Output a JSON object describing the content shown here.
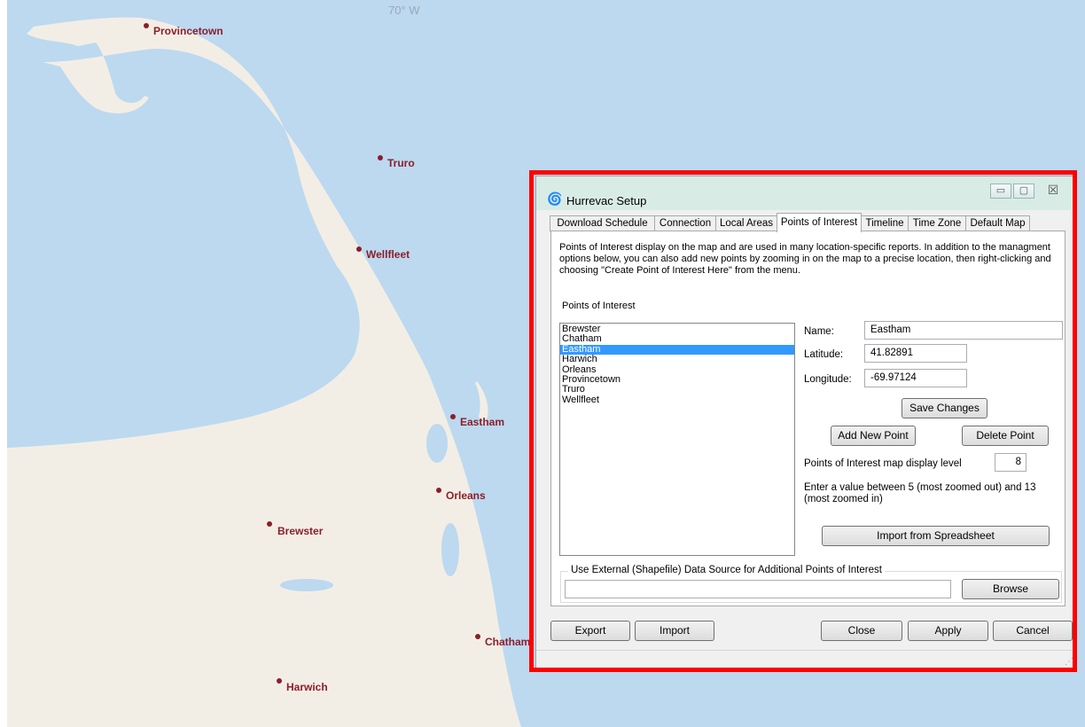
{
  "map": {
    "longitude_label": "70° W",
    "colors": {
      "water": "#bcd9f0",
      "land": "#f3eee5",
      "town": "#8b1e2a"
    },
    "towns": [
      {
        "name": "Provincetown"
      },
      {
        "name": "Truro"
      },
      {
        "name": "Wellfleet"
      },
      {
        "name": "Eastham"
      },
      {
        "name": "Orleans"
      },
      {
        "name": "Brewster"
      },
      {
        "name": "Chatham"
      },
      {
        "name": "Harwich"
      }
    ]
  },
  "dialog": {
    "title": "Hurrevac Setup",
    "title_icon": "hurricane-icon",
    "window_controls": {
      "minimize": "▭",
      "maximize": "▢",
      "close": "☒"
    },
    "tabs": [
      {
        "label": "Download Schedule",
        "active": false
      },
      {
        "label": "Connection",
        "active": false
      },
      {
        "label": "Local Areas",
        "active": false
      },
      {
        "label": "Points of Interest",
        "active": true
      },
      {
        "label": "Timeline",
        "active": false
      },
      {
        "label": "Time Zone",
        "active": false
      },
      {
        "label": "Default Map",
        "active": false
      }
    ],
    "description": "Points of Interest display on the map and are used in many location-specific reports.  In addition to the managment options below, you can also add new points by zooming in on the map to a precise location, then right-clicking and choosing \"Create Point of Interest Here\" from the menu.",
    "list_label": "Points of Interest",
    "points": [
      "Brewster",
      "Chatham",
      "Eastham",
      "Harwich",
      "Orleans",
      "Provincetown",
      "Truro",
      "Wellfleet"
    ],
    "selected_point": "Eastham",
    "name_label": "Name:",
    "name_value": "Eastham",
    "latitude_label": "Latitude:",
    "latitude_value": "41.82891",
    "longitude_label": "Longitude:",
    "longitude_value": "-69.97124",
    "save_changes": "Save Changes",
    "add_new_point": "Add New Point",
    "delete_point": "Delete Point",
    "display_level_label": "Points of Interest map display level",
    "display_level_value": "8",
    "display_level_hint": "Enter a value between 5 (most zoomed out) and 13 (most zoomed in)",
    "import_spreadsheet": "Import from Spreadsheet",
    "external_source_label": "Use External (Shapefile) Data Source for Additional Points of Interest",
    "external_source_value": "",
    "browse": "Browse",
    "export": "Export",
    "import": "Import",
    "close": "Close",
    "apply": "Apply",
    "cancel": "Cancel",
    "highlight_color": "#ff0000"
  }
}
